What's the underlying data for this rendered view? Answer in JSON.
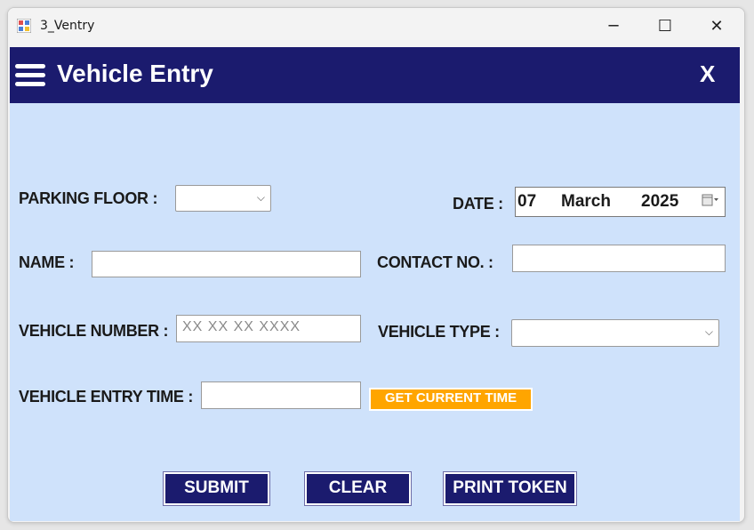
{
  "window": {
    "title": "3_Ventry",
    "app_icon": "form-app-icon",
    "controls": {
      "minimize": "─",
      "maximize": "☐",
      "close": "✕"
    }
  },
  "header": {
    "menu_icon": "hamburger-menu-icon",
    "title": "Vehicle Entry",
    "close_label": "X"
  },
  "colors": {
    "header_bg": "#1b1b6e",
    "content_bg": "#cfe2fb",
    "accent_orange": "#ffa500",
    "button_bg": "#1b1b6e"
  },
  "form": {
    "parking_floor": {
      "label": "PARKING FLOOR :",
      "value": ""
    },
    "date": {
      "label": "DATE :",
      "day": "07",
      "month": "March",
      "year": "2025",
      "icon": "calendar-dropdown-icon"
    },
    "name": {
      "label": "NAME :",
      "value": ""
    },
    "contact": {
      "label": "CONTACT NO. :",
      "value": ""
    },
    "vehicle_number": {
      "label": "VEHICLE NUMBER :",
      "value": "",
      "placeholder": "XX XX XX XXXX"
    },
    "vehicle_type": {
      "label": "VEHICLE TYPE :",
      "value": ""
    },
    "entry_time": {
      "label": "VEHICLE ENTRY TIME  :",
      "value": ""
    },
    "get_current_time_label": "GET CURRENT TIME"
  },
  "buttons": {
    "submit": "SUBMIT",
    "clear": "CLEAR",
    "print_token": "PRINT TOKEN"
  }
}
